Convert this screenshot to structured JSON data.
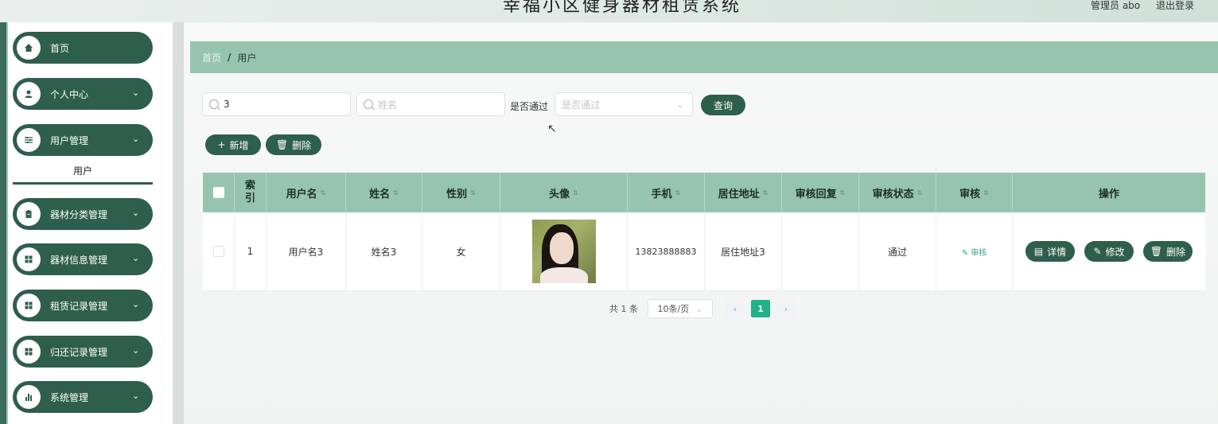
{
  "header": {
    "title": "幸福小区健身器材租赁系统",
    "user_label": "管理员 abo",
    "logout": "退出登录"
  },
  "sidebar": {
    "items": [
      {
        "label": "首页",
        "icon": "home-icon"
      },
      {
        "label": "个人中心",
        "icon": "user-icon"
      },
      {
        "label": "用户管理",
        "icon": "sliders-icon"
      },
      {
        "label": "器材分类管理",
        "icon": "clipboard-icon"
      },
      {
        "label": "器材信息管理",
        "icon": "grid-icon"
      },
      {
        "label": "租赁记录管理",
        "icon": "grid-icon"
      },
      {
        "label": "归还记录管理",
        "icon": "grid-icon"
      },
      {
        "label": "系统管理",
        "icon": "chart-icon"
      }
    ],
    "submenu_active": "用户"
  },
  "breadcrumb": {
    "home": "首页",
    "separator": "/",
    "current": "用户"
  },
  "filters": {
    "username_value": "3",
    "name_placeholder": "姓名",
    "passed_label": "是否通过",
    "passed_placeholder": "是否通过",
    "query_button": "查询"
  },
  "actions": {
    "add": "新增",
    "delete": "删除"
  },
  "table": {
    "columns": [
      "索引",
      "用户名",
      "姓名",
      "性别",
      "头像",
      "手机",
      "居住地址",
      "审核回复",
      "审核状态",
      "审核",
      "操作"
    ],
    "rows": [
      {
        "index": "1",
        "username": "用户名3",
        "name": "姓名3",
        "gender": "女",
        "phone": "13823888883",
        "address": "居住地址3",
        "reply": "",
        "status": "通过",
        "audit": "审核",
        "detail": "详情",
        "edit": "修改",
        "remove": "删除"
      }
    ]
  },
  "pagination": {
    "total_text": "共 1 条",
    "page_size": "10条/页",
    "current_page": "1",
    "prev": "‹",
    "next": "›"
  },
  "colors": {
    "primary": "#2e5e4c",
    "header_green": "#97c4b1",
    "active_page": "#20b286"
  }
}
